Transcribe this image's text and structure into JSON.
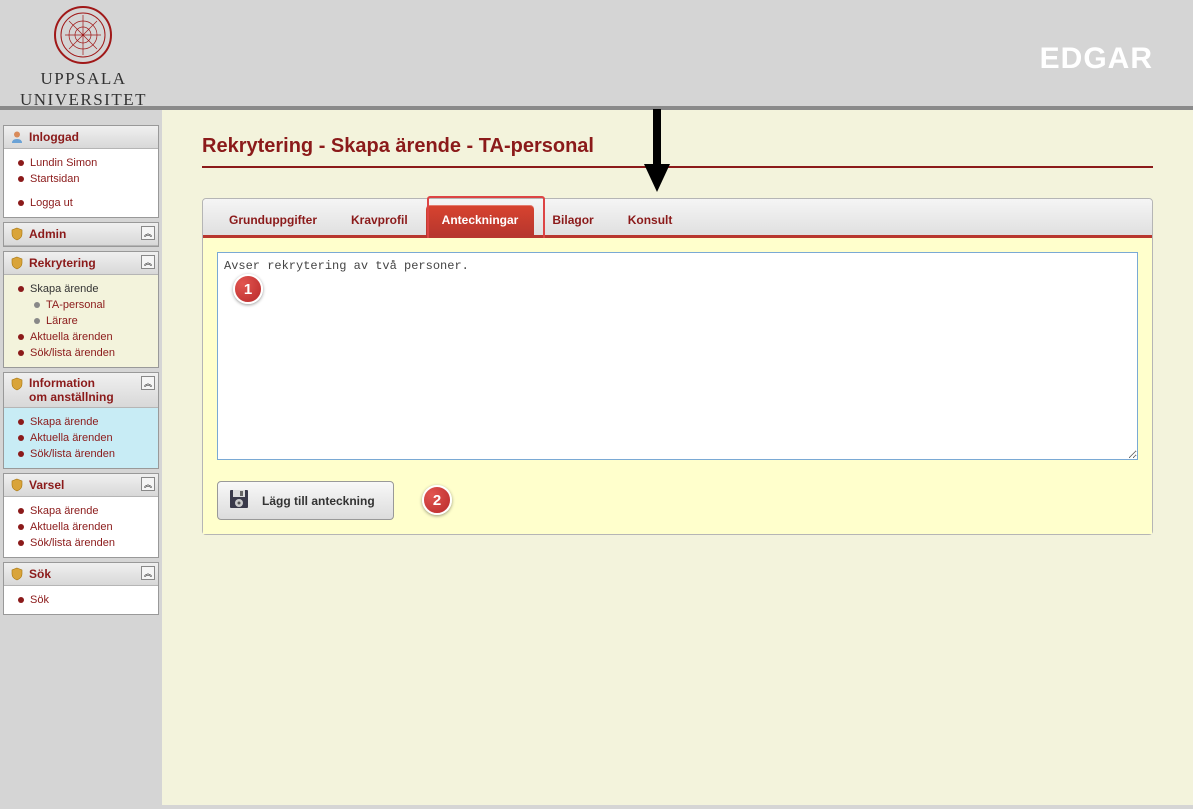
{
  "header": {
    "university_line1": "UPPSALA",
    "university_line2": "UNIVERSITET",
    "app_name": "EDGAR"
  },
  "sidebar": {
    "inloggad": {
      "title": "Inloggad",
      "user": "Lundin Simon",
      "start": "Startsidan",
      "logout": "Logga ut"
    },
    "admin": {
      "title": "Admin"
    },
    "rekrytering": {
      "title": "Rekrytering",
      "skapa": "Skapa ärende",
      "ta": "TA-personal",
      "larare": "Lärare",
      "aktuella": "Aktuella ärenden",
      "sok": "Sök/lista ärenden"
    },
    "info": {
      "title_l1": "Information",
      "title_l2": "om anställning",
      "skapa": "Skapa ärende",
      "aktuella": "Aktuella ärenden",
      "sok": "Sök/lista ärenden"
    },
    "varsel": {
      "title": "Varsel",
      "skapa": "Skapa ärende",
      "aktuella": "Aktuella ärenden",
      "sok": "Sök/lista ärenden"
    },
    "sok": {
      "title": "Sök",
      "sok": "Sök"
    }
  },
  "main": {
    "page_title": "Rekrytering - Skapa ärende - TA-personal",
    "tabs": {
      "grund": "Grunduppgifter",
      "krav": "Kravprofil",
      "anteck": "Anteckningar",
      "bilagor": "Bilagor",
      "konsult": "Konsult"
    },
    "textarea_value": "Avser rekrytering av två personer.",
    "add_note_label": "Lägg till anteckning"
  },
  "badges": {
    "one": "1",
    "two": "2"
  }
}
